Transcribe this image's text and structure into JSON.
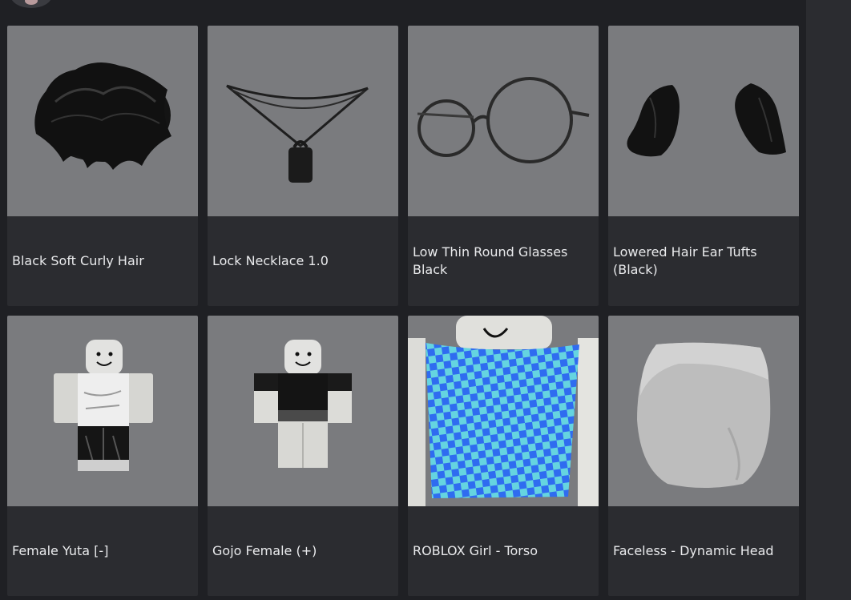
{
  "items": [
    {
      "name": "Black Soft Curly Hair",
      "icon": "hair-icon"
    },
    {
      "name": "Lock Necklace 1.0",
      "icon": "necklace-icon"
    },
    {
      "name": "Low Thin Round Glasses Black",
      "icon": "glasses-icon"
    },
    {
      "name": "Lowered Hair Ear Tufts (Black)",
      "icon": "hair-tufts-icon"
    },
    {
      "name": "Female Yuta [-]",
      "icon": "avatar-outfit-icon"
    },
    {
      "name": "Gojo Female (+)",
      "icon": "avatar-outfit-icon"
    },
    {
      "name": "ROBLOX Girl - Torso",
      "icon": "torso-icon"
    },
    {
      "name": "Faceless - Dynamic Head",
      "icon": "head-icon"
    }
  ],
  "colors": {
    "background": "#1f2024",
    "card": "#2b2c30",
    "thumbnail": "#7a7b7e",
    "text": "#e9eaec"
  }
}
